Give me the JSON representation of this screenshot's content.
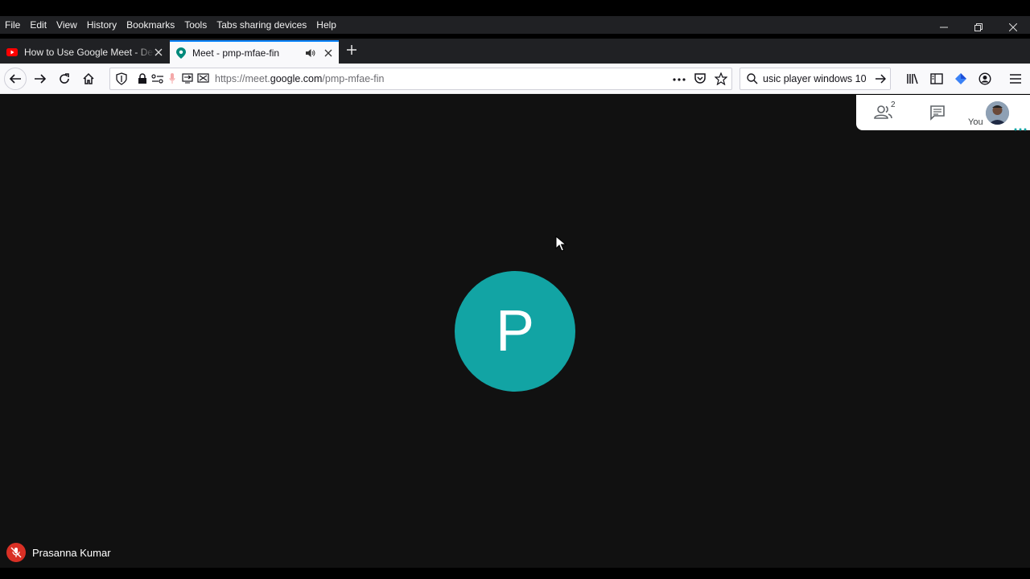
{
  "menu": [
    "File",
    "Edit",
    "View",
    "History",
    "Bookmarks",
    "Tools",
    "Tabs sharing devices",
    "Help"
  ],
  "tabs": [
    {
      "title": "How to Use Google Meet - Detailed",
      "icon": "youtube-icon"
    },
    {
      "title": "Meet - pmp-mfae-fin",
      "icon": "google-meet-icon"
    }
  ],
  "url": {
    "prefix": "https://meet.",
    "domain": "google.com",
    "path": "/pmp-mfae-fin"
  },
  "search": {
    "value": "usic player windows 10"
  },
  "meet": {
    "participants_count": "2",
    "self_label": "You",
    "avatar_letter": "P",
    "participant_name": "Prasanna Kumar"
  },
  "colors": {
    "avatar_bg": "#12a4a4",
    "mic_off": "#d93025",
    "accent": "#0a84ff"
  }
}
